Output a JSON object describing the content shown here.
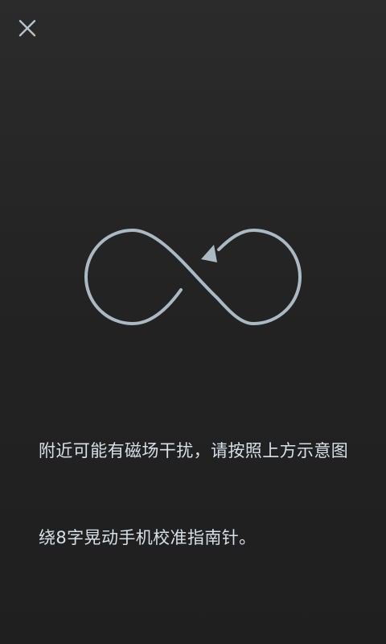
{
  "header": {
    "close_icon": "close-icon"
  },
  "illustration": {
    "name": "figure-eight-icon",
    "stroke_color": "#a9bac4"
  },
  "message": {
    "line1": "附近可能有磁场干扰，请按照上方示意图",
    "line2": "绕8字晃动手机校准指南针。"
  },
  "colors": {
    "background_top": "#2b2b2b",
    "background_bottom": "#1f1f1f",
    "text": "#d7e0e8"
  }
}
